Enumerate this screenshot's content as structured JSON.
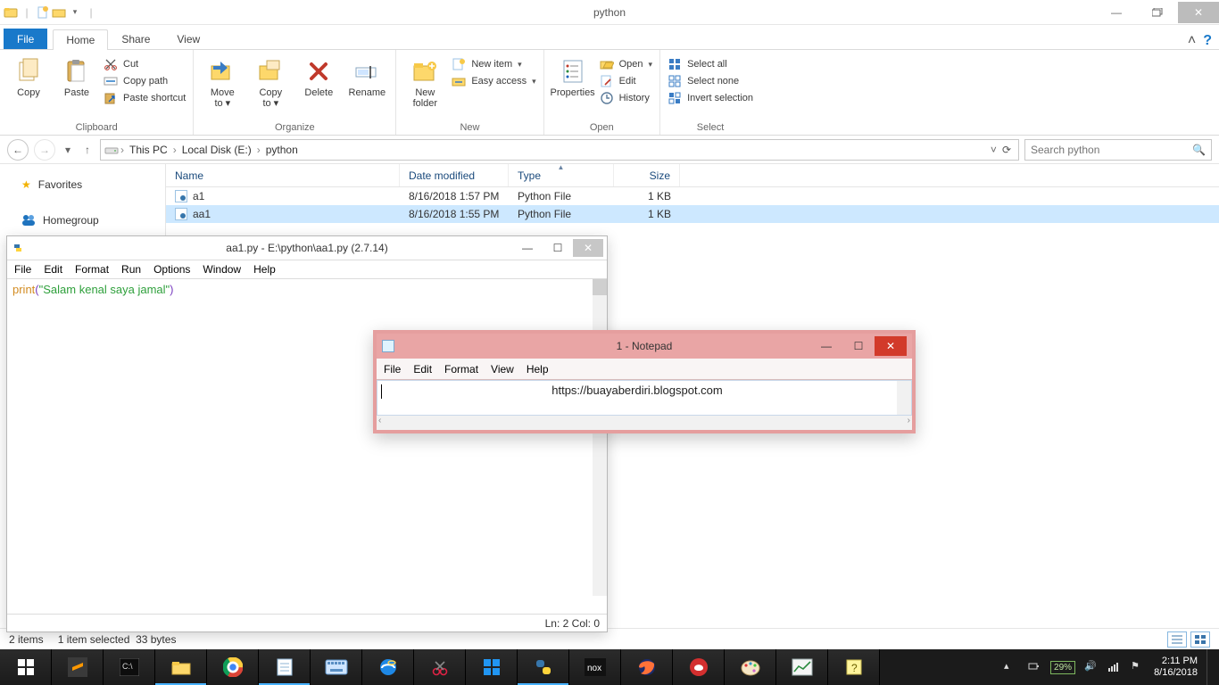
{
  "explorer": {
    "title": "python",
    "qat_aria": {
      "dropdown": "▾"
    },
    "tabs": {
      "file": "File",
      "home": "Home",
      "share": "Share",
      "view": "View"
    },
    "ribbon": {
      "clipboard": {
        "label": "Clipboard",
        "copy": "Copy",
        "paste": "Paste",
        "cut": "Cut",
        "copy_path": "Copy path",
        "paste_shortcut": "Paste shortcut"
      },
      "organize": {
        "label": "Organize",
        "move_to": "Move\nto ▾",
        "copy_to": "Copy\nto ▾",
        "delete": "Delete",
        "rename": "Rename"
      },
      "new": {
        "label": "New",
        "new_folder": "New\nfolder",
        "new_item": "New item",
        "easy_access": "Easy access"
      },
      "open": {
        "label": "Open",
        "properties": "Properties",
        "open": "Open",
        "edit": "Edit",
        "history": "History"
      },
      "select": {
        "label": "Select",
        "select_all": "Select all",
        "select_none": "Select none",
        "invert": "Invert selection"
      }
    },
    "address": {
      "segments": [
        "This PC",
        "Local Disk  (E:)",
        "python"
      ],
      "refresh_tip": "Refresh",
      "search_placeholder": "Search python"
    },
    "nav": {
      "favorites": "Favorites",
      "homegroup": "Homegroup"
    },
    "columns": {
      "name": "Name",
      "modified": "Date modified",
      "type": "Type",
      "size": "Size"
    },
    "rows": [
      {
        "name": "a1",
        "modified": "8/16/2018 1:57 PM",
        "type": "Python File",
        "size": "1 KB",
        "selected": false
      },
      {
        "name": "aa1",
        "modified": "8/16/2018 1:55 PM",
        "type": "Python File",
        "size": "1 KB",
        "selected": true
      }
    ],
    "status": {
      "count": "2 items",
      "selection": "1 item selected",
      "bytes": "33 bytes"
    }
  },
  "idle": {
    "title": "aa1.py - E:\\python\\aa1.py (2.7.14)",
    "menu": [
      "File",
      "Edit",
      "Format",
      "Run",
      "Options",
      "Window",
      "Help"
    ],
    "code_kw": "print",
    "code_par_open": "(",
    "code_str": "\"Salam kenal saya jamal\"",
    "code_par_close": ")",
    "status": "Ln: 2  Col: 0"
  },
  "notepad": {
    "title": "1 - Notepad",
    "menu": [
      "File",
      "Edit",
      "Format",
      "View",
      "Help"
    ],
    "content": "https://buayaberdiri.blogspot.com"
  },
  "taskbar": {
    "time": "2:11 PM",
    "date": "8/16/2018",
    "battery": "29%"
  }
}
